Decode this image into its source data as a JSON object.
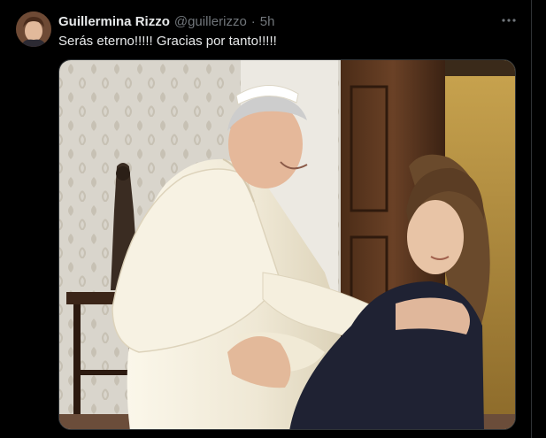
{
  "tweet": {
    "author_name": "Guillermina Rizzo",
    "handle": "@guillerizzo",
    "separator": "·",
    "time": "5h",
    "text": "Serás eterno!!!!! Gracias por tanto!!!!!"
  },
  "icons": {
    "avatar": "avatar",
    "more": "more-icon"
  },
  "colors": {
    "background": "#000000",
    "primary_text": "#e7e9ea",
    "secondary_text": "#71767b",
    "border": "#2f3336"
  }
}
